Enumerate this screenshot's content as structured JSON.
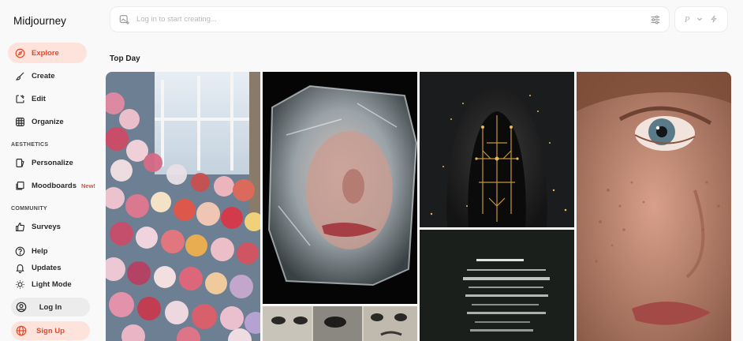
{
  "app": {
    "name": "Midjourney"
  },
  "nav": {
    "explore": "Explore",
    "create": "Create",
    "edit": "Edit",
    "organize": "Organize"
  },
  "sections": {
    "aesthetics": "AESTHETICS",
    "community": "COMMUNITY"
  },
  "aesthetics": {
    "personalize": "Personalize",
    "moodboards": "Moodboards",
    "moodboards_badge": "New!"
  },
  "community": {
    "surveys": "Surveys"
  },
  "footer_nav": {
    "help": "Help",
    "updates": "Updates",
    "light_mode": "Light Mode"
  },
  "auth": {
    "login": "Log In",
    "signup": "Sign Up"
  },
  "prompt": {
    "placeholder": "Log in to start creating..."
  },
  "mini_bar": {
    "p_label": "P"
  },
  "feed": {
    "title": "Top Day",
    "images": [
      {
        "subject": "flower-room"
      },
      {
        "subject": "ice-face"
      },
      {
        "subject": "newspaper-faces"
      },
      {
        "subject": "hooded-circuit-face"
      },
      {
        "subject": "motion-blur-lines"
      },
      {
        "subject": "freckled-face-closeup"
      }
    ]
  },
  "colors": {
    "accent": "#e24a2c",
    "active_bg": "#fde3dc",
    "page_bg": "#f9f9f9"
  }
}
